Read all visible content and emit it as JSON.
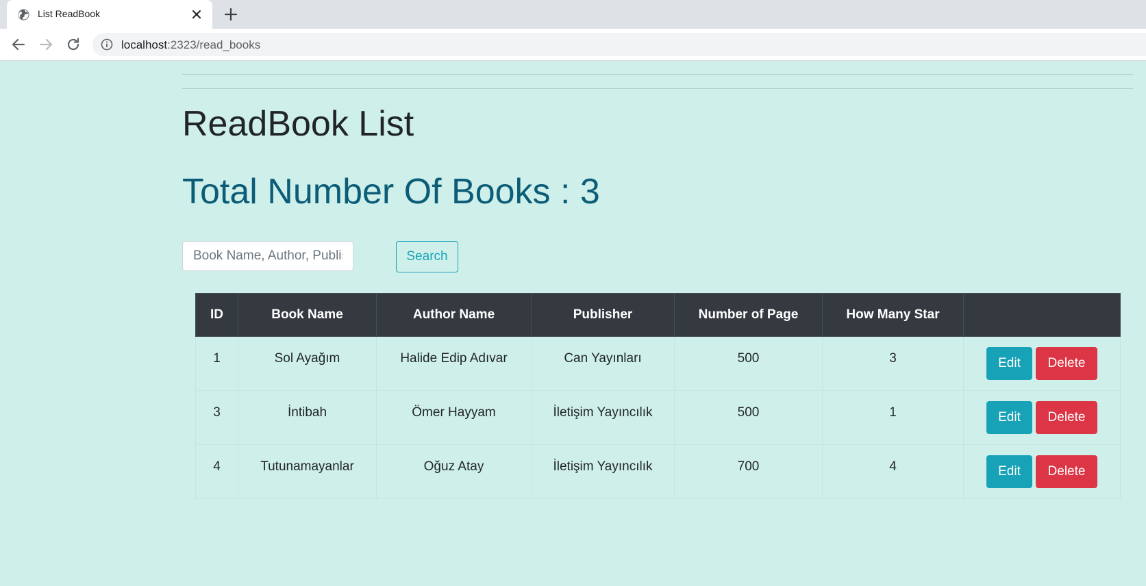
{
  "browser": {
    "tab_title": "List ReadBook",
    "url_host": "localhost",
    "url_path": ":2323/read_books"
  },
  "page": {
    "title": "ReadBook List",
    "total_label": "Total Number Of Books : 3",
    "search": {
      "placeholder": "Book Name, Author, Publisher",
      "value": "",
      "button_label": "Search"
    }
  },
  "table": {
    "headers": [
      "ID",
      "Book Name",
      "Author Name",
      "Publisher",
      "Number of Page",
      "How Many Star",
      ""
    ],
    "rows": [
      {
        "id": "1",
        "book": "Sol Ayağım",
        "author": "Halide Edip Adıvar",
        "publisher": "Can Yayınları",
        "pages": "500",
        "stars": "3"
      },
      {
        "id": "3",
        "book": "İntibah",
        "author": "Ömer Hayyam",
        "publisher": "İletişim Yayıncılık",
        "pages": "500",
        "stars": "1"
      },
      {
        "id": "4",
        "book": "Tutunamayanlar",
        "author": "Oğuz Atay",
        "publisher": "İletişim Yayıncılık",
        "pages": "700",
        "stars": "4"
      }
    ],
    "edit_label": "Edit",
    "delete_label": "Delete"
  },
  "colors": {
    "page_bg": "#cff0ea",
    "title_accent": "#0c5c78",
    "info": "#17a2b8",
    "danger": "#dc3545",
    "table_header": "#343a40"
  },
  "icons": [
    "globe-icon",
    "close-icon",
    "plus-icon",
    "back-arrow-icon",
    "forward-arrow-icon",
    "reload-icon",
    "info-icon"
  ]
}
